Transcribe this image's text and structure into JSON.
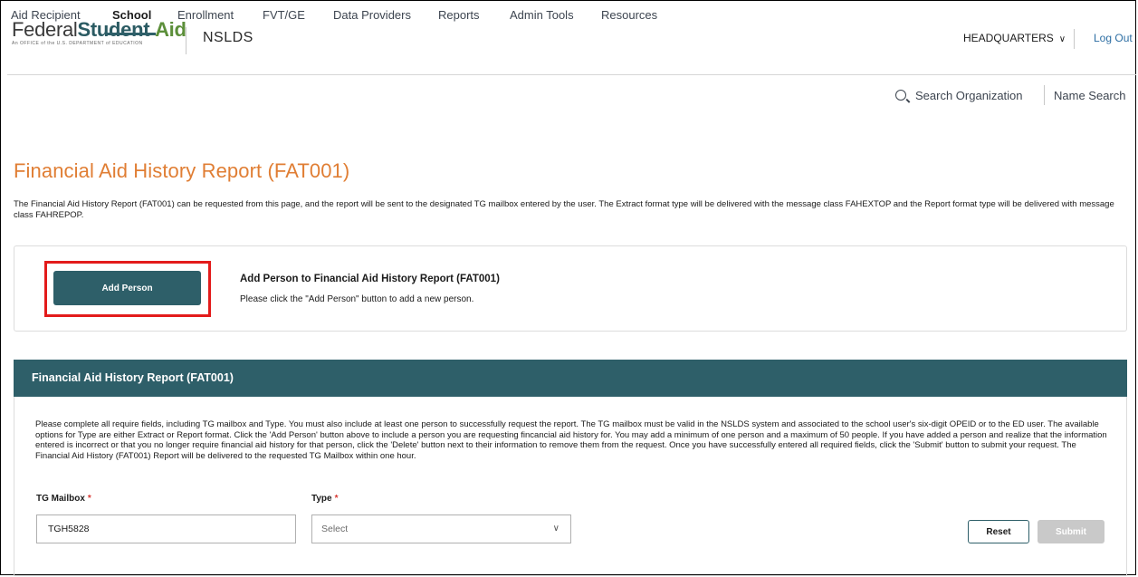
{
  "header": {
    "logo_word1": "Federal",
    "logo_word2": "Student",
    "logo_word3": "Aid",
    "logo_tagline": "An OFFICE of the U.S. DEPARTMENT of EDUCATION",
    "app_name": "NSLDS",
    "org_selector": "HEADQUARTERS",
    "logout": "Log Out"
  },
  "nav": {
    "items": [
      {
        "label": "Aid Recipient"
      },
      {
        "label": "School"
      },
      {
        "label": "Enrollment"
      },
      {
        "label": "FVT/GE"
      },
      {
        "label": "Data Providers"
      },
      {
        "label": "Reports"
      },
      {
        "label": "Admin Tools"
      },
      {
        "label": "Resources"
      }
    ],
    "active": "School",
    "search_org": "Search Organization",
    "name_search": "Name Search"
  },
  "page": {
    "title": "Financial Aid History Report (FAT001)",
    "intro": "The Financial Aid History Report (FAT001) can be requested from this page, and the report will be sent to the designated TG mailbox entered by the user. The Extract format type will be delivered with the message class FAHEXTOP and the Report format type will be delivered with message class FAHREPOP."
  },
  "add_person": {
    "button_label": "Add Person",
    "title": "Add Person to Financial Aid History Report (FAT001)",
    "description": "Please click the \"Add Person\" button to add a new person."
  },
  "form": {
    "panel_title": "Financial Aid History Report (FAT001)",
    "instructions": "Please complete all require fields, including TG mailbox and Type. You must also include at least one person to successfully request the report. The TG mailbox must be valid in the NSLDS system and associated to the school user's six-digit OPEID or to the ED user. The available options for Type are either Extract or Report format. Click the 'Add Person' button above to include a person you are requesting fincancial aid history for. You may add a minimum of one person and a maximum of 50 people. If you have added a person and realize that the information entered is incorrect or that you no longer require financial aid history for that person, click the 'Delete' button next to their information to remove them from the request. Once you have successfully entered all required fields, click the 'Submit' button to submit your request. The Financial Aid History (FAT001) Report will be delivered to the requested TG Mailbox within one hour.",
    "tg_mailbox_label": "TG Mailbox",
    "tg_mailbox_value": "TGH5828",
    "type_label": "Type",
    "type_value": "Select",
    "required_marker": "*",
    "reset_label": "Reset",
    "submit_label": "Submit"
  },
  "colors": {
    "brand_teal": "#2e5f69",
    "title_orange": "#e07e34",
    "highlight_red": "#e31b1b",
    "link_blue": "#2d6ea3"
  }
}
